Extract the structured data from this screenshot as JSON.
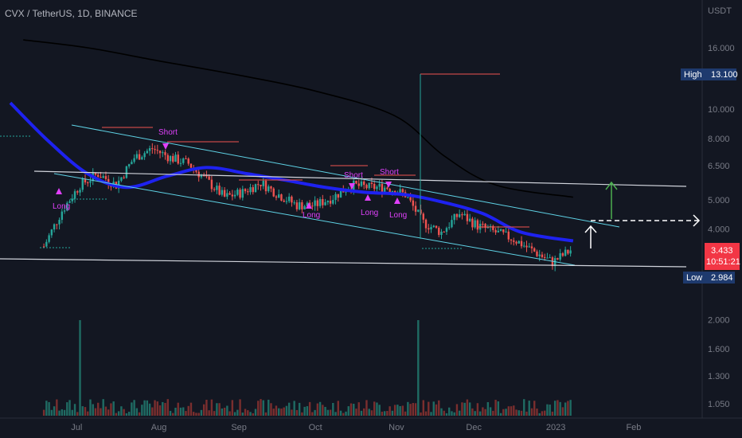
{
  "header": {
    "symbol": "CVX / TetherUS, 1D, BINANCE"
  },
  "price_axis": {
    "unit": "USDT",
    "ticks": [
      "16.000",
      "10.000",
      "8.000",
      "6.500",
      "5.000",
      "4.000",
      "2.000",
      "1.600",
      "1.300",
      "1.050"
    ],
    "high_label": "High",
    "high_value": "13.100",
    "low_label": "Low",
    "low_value": "2.984",
    "current_price": "3.433",
    "countdown": "10:51:21"
  },
  "time_axis": {
    "ticks": [
      "Jul",
      "Aug",
      "Sep",
      "Oct",
      "Nov",
      "Dec",
      "2023",
      "Feb"
    ]
  },
  "signals": [
    {
      "type": "Short",
      "text": "Short"
    },
    {
      "type": "Short",
      "text": "Short"
    },
    {
      "type": "Short",
      "text": "Short"
    },
    {
      "type": "Long",
      "text": "Long"
    },
    {
      "type": "Long",
      "text": "Long"
    },
    {
      "type": "Long",
      "text": "Long"
    },
    {
      "type": "Long",
      "text": "Long"
    }
  ],
  "colors": {
    "background": "#131722",
    "up": "#26a69a",
    "down": "#ef5350",
    "ma_fast": "#1e22f0",
    "ma_slow": "#0b0d12",
    "channel": "#5fd3e6",
    "horizontal": "#d1d4dc",
    "signal": "#e040fb",
    "price_tag": "#f23645",
    "high_low_tag": "#1e3a6e",
    "arrow_up": "#4caf50"
  },
  "chart_data": {
    "type": "candlestick",
    "title": "CVX / TetherUS, 1D, BINANCE",
    "y_scale": "log",
    "ylim": [
      0.95,
      20
    ],
    "ytick_values": [
      16,
      10,
      8,
      6.5,
      5,
      4,
      2,
      1.6,
      1.3,
      1.05
    ],
    "x_months": [
      "Jul",
      "Aug",
      "Sep",
      "Oct",
      "Nov",
      "Dec",
      "2023",
      "Feb"
    ],
    "series": [
      {
        "name": "close",
        "points": [
          [
            "2022-06-18",
            3.5
          ],
          [
            "2022-06-25",
            4.6
          ],
          [
            "2022-07-02",
            5.6
          ],
          [
            "2022-07-09",
            6.1
          ],
          [
            "2022-07-16",
            5.6
          ],
          [
            "2022-07-23",
            6.9
          ],
          [
            "2022-07-30",
            7.4
          ],
          [
            "2022-08-06",
            6.9
          ],
          [
            "2022-08-13",
            6.6
          ],
          [
            "2022-08-20",
            5.8
          ],
          [
            "2022-08-27",
            5.1
          ],
          [
            "2022-09-03",
            5.3
          ],
          [
            "2022-09-10",
            5.7
          ],
          [
            "2022-09-17",
            5.2
          ],
          [
            "2022-09-24",
            4.8
          ],
          [
            "2022-10-01",
            4.8
          ],
          [
            "2022-10-08",
            5.1
          ],
          [
            "2022-10-15",
            5.6
          ],
          [
            "2022-10-22",
            5.5
          ],
          [
            "2022-10-29",
            5.5
          ],
          [
            "2022-11-05",
            5.2
          ],
          [
            "2022-11-12",
            4.2
          ],
          [
            "2022-11-19",
            3.9
          ],
          [
            "2022-11-26",
            4.5
          ],
          [
            "2022-12-03",
            4.1
          ],
          [
            "2022-12-10",
            3.9
          ],
          [
            "2022-12-17",
            3.7
          ],
          [
            "2022-12-24",
            3.4
          ],
          [
            "2023-01-01",
            3.1
          ],
          [
            "2023-01-08",
            3.4
          ]
        ]
      },
      {
        "name": "ma_fast",
        "points": [
          [
            "2022-06-05",
            10.5
          ],
          [
            "2022-06-20",
            7.8
          ],
          [
            "2022-07-05",
            6.1
          ],
          [
            "2022-07-20",
            5.5
          ],
          [
            "2022-08-05",
            6.0
          ],
          [
            "2022-08-20",
            6.4
          ],
          [
            "2022-09-05",
            6.1
          ],
          [
            "2022-09-20",
            5.8
          ],
          [
            "2022-10-05",
            5.5
          ],
          [
            "2022-10-20",
            5.3
          ],
          [
            "2022-11-05",
            5.2
          ],
          [
            "2022-11-20",
            4.9
          ],
          [
            "2022-12-05",
            4.5
          ],
          [
            "2022-12-20",
            3.9
          ],
          [
            "2023-01-09",
            3.65
          ]
        ]
      },
      {
        "name": "ma_slow",
        "points": [
          [
            "2022-06-10",
            17.0
          ],
          [
            "2022-07-05",
            16.0
          ],
          [
            "2022-08-01",
            14.5
          ],
          [
            "2022-09-01",
            13.0
          ],
          [
            "2022-10-01",
            11.5
          ],
          [
            "2022-11-01",
            9.5
          ],
          [
            "2022-11-20",
            7.0
          ],
          [
            "2022-12-10",
            5.6
          ],
          [
            "2023-01-09",
            5.1
          ]
        ]
      }
    ],
    "volume_spikes": [
      {
        "x": "2022-07-02",
        "label": "high"
      },
      {
        "x": "2022-11-10",
        "label": "high"
      }
    ],
    "annotations": [
      {
        "text": "Short",
        "x": "2022-08-01",
        "y": 7.6
      },
      {
        "text": "Short",
        "x": "2022-10-22",
        "y": 5.7
      },
      {
        "text": "Short",
        "x": "2022-11-05",
        "y": 5.8
      },
      {
        "text": "Long",
        "x": "2022-07-02",
        "y": 5.4
      },
      {
        "text": "Long",
        "x": "2022-10-09",
        "y": 5.0
      },
      {
        "text": "Long",
        "x": "2022-10-29",
        "y": 5.1
      },
      {
        "text": "Long",
        "x": "2022-11-05",
        "y": 4.9
      }
    ],
    "grid": false,
    "legend": "none"
  }
}
